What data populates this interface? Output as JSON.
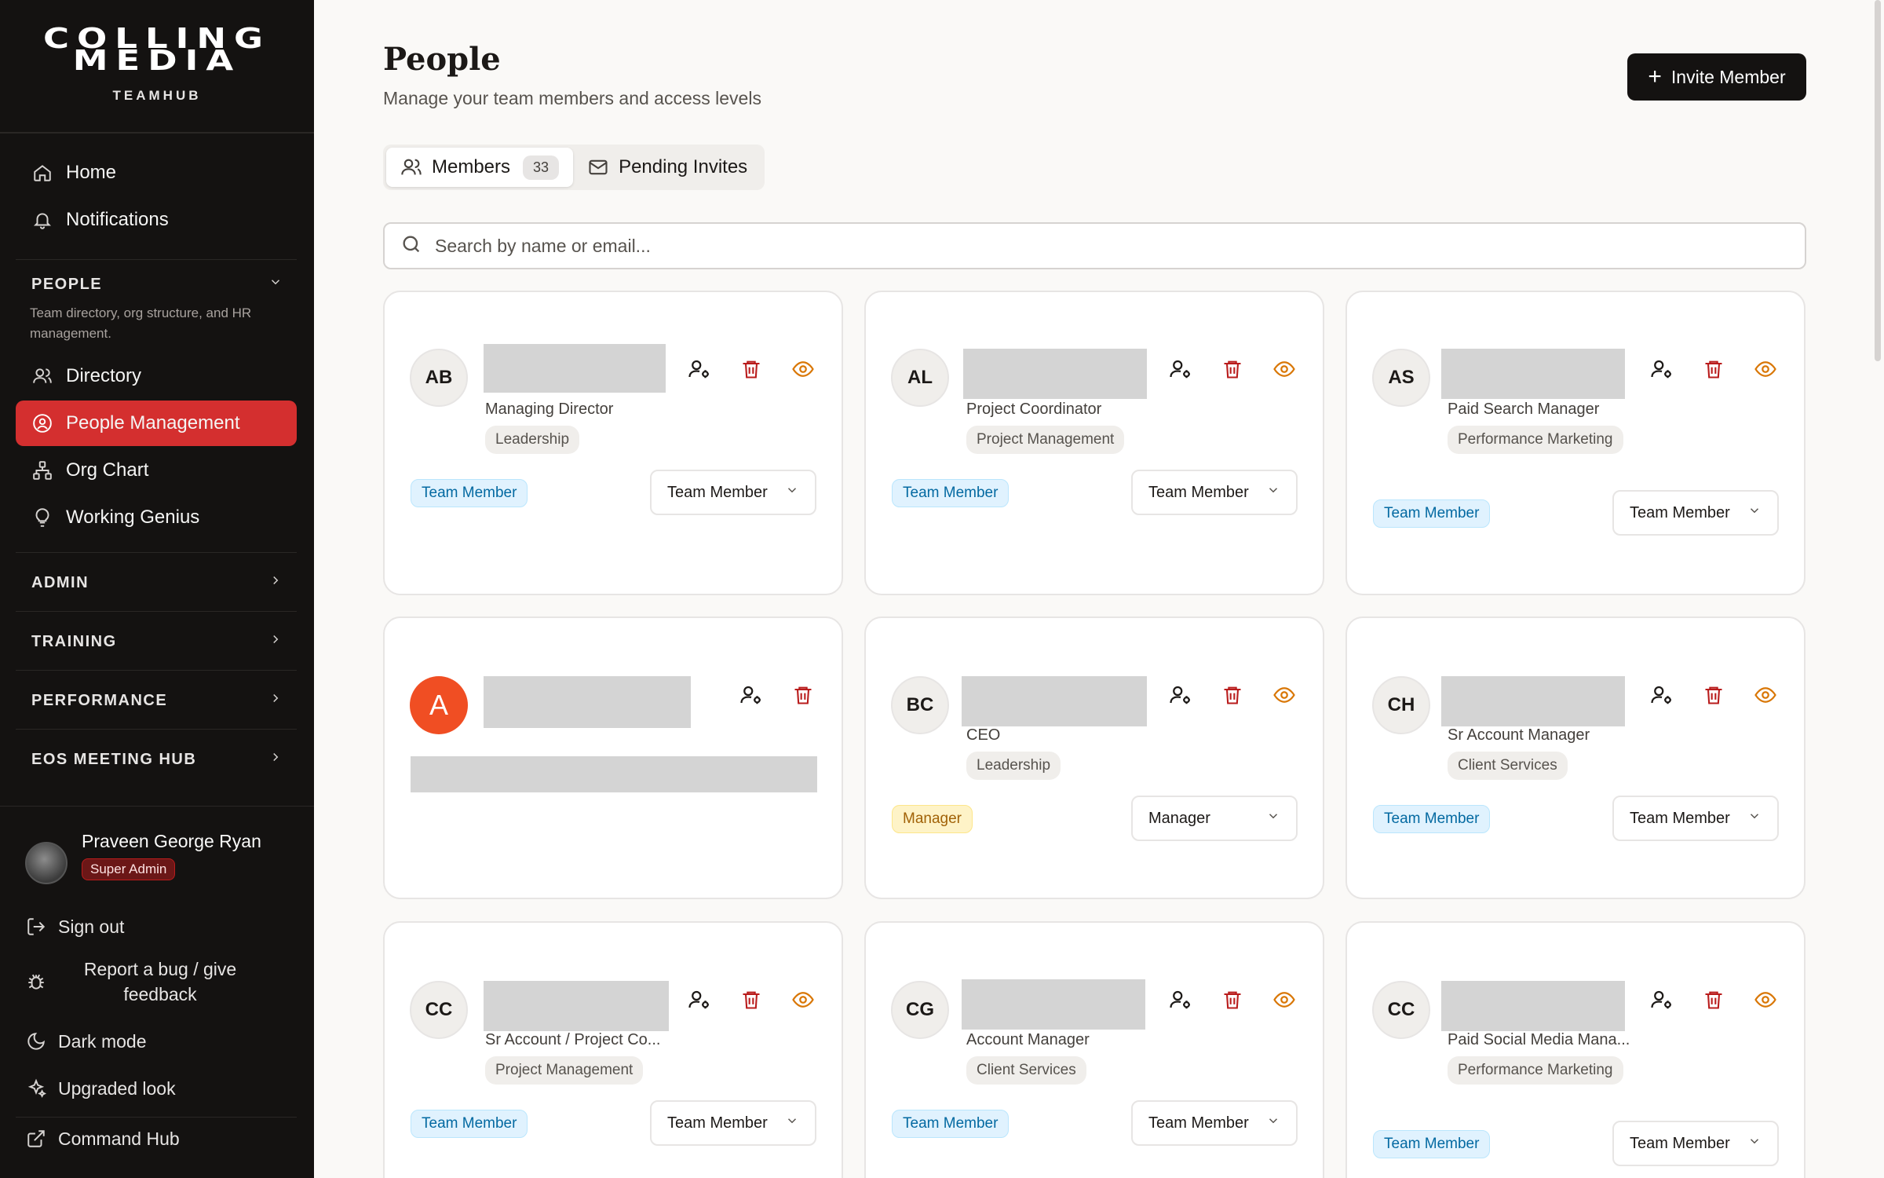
{
  "brand": {
    "logo_line1": "COLLING",
    "logo_line2": "MEDIA",
    "logo_sub": "TEAMHUB"
  },
  "nav": {
    "home": "Home",
    "notifications": "Notifications",
    "people_section": "PEOPLE",
    "people_desc": "Team directory, org structure, and HR management.",
    "directory": "Directory",
    "people_management": "People Management",
    "org_chart": "Org Chart",
    "working_genius": "Working Genius",
    "admin": "ADMIN",
    "training": "TRAINING",
    "performance": "PERFORMANCE",
    "eos": "EOS MEETING HUB"
  },
  "user": {
    "name": "Praveen George Ryan",
    "role": "Super Admin"
  },
  "footer": {
    "sign_out": "Sign out",
    "report_bug": "Report a bug / give feedback",
    "dark_mode": "Dark mode",
    "upgraded_look": "Upgraded look",
    "command_hub": "Command Hub"
  },
  "header": {
    "title": "People",
    "subtitle": "Manage your team members and access levels",
    "invite_label": "Invite Member"
  },
  "tabs": {
    "members": "Members",
    "members_count": "33",
    "pending": "Pending Invites"
  },
  "search": {
    "placeholder": "Search by name or email..."
  },
  "cards": [
    {
      "initials": "AB",
      "role": "Managing Director",
      "dept": "Leadership",
      "access": "Team Member",
      "select": "Team Member"
    },
    {
      "initials": "AL",
      "role": "Project Coordinator",
      "dept": "Project Management",
      "access": "Team Member",
      "select": "Team Member"
    },
    {
      "initials": "AS",
      "role": "Paid Search Manager",
      "dept": "Performance Marketing",
      "access": "Team Member",
      "select": "Team Member"
    },
    {
      "initials": "A"
    },
    {
      "initials": "BC",
      "role": "CEO",
      "dept": "Leadership",
      "access": "Manager",
      "select": "Manager"
    },
    {
      "initials": "CH",
      "role": "Sr Account Manager",
      "dept": "Client Services",
      "access": "Team Member",
      "select": "Team Member"
    },
    {
      "initials": "CC",
      "role": "Sr Account / Project Co...",
      "dept": "Project Management",
      "access": "Team Member",
      "select": "Team Member"
    },
    {
      "initials": "CG",
      "role": "Account Manager",
      "dept": "Client Services",
      "access": "Team Member",
      "select": "Team Member"
    },
    {
      "initials": "CC",
      "role": "Paid Social Media Mana...",
      "dept": "Performance Marketing",
      "access": "Team Member",
      "select": "Team Member"
    }
  ],
  "colors": {
    "accent": "#d42f2f",
    "sidebar_bg": "#141211",
    "manager_badge": "#fef3c7",
    "team_member_badge": "#e0f2fe"
  }
}
